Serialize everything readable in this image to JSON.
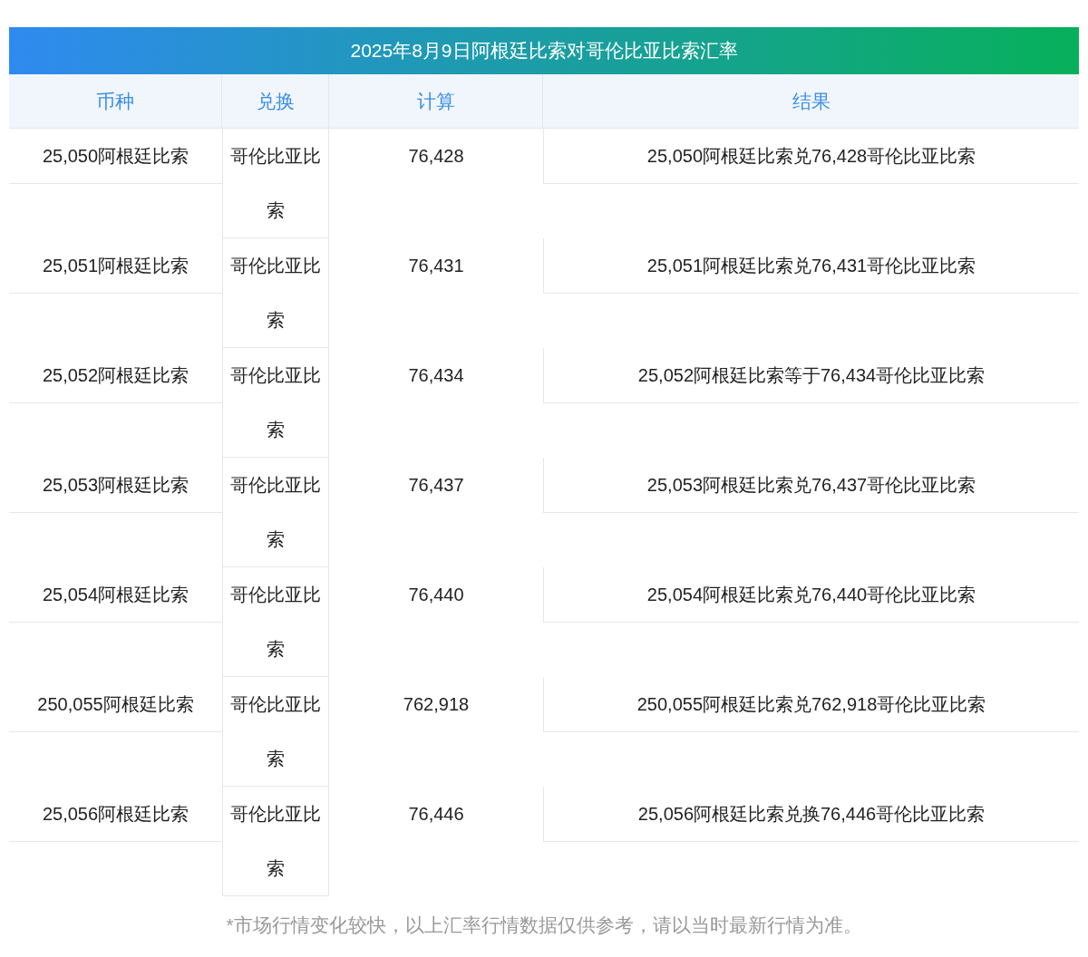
{
  "title": "2025年8月9日阿根廷比索对哥伦比亚比索汇率",
  "columns": [
    "币种",
    "兑换",
    "计算",
    "结果"
  ],
  "rows": [
    {
      "currency": "25,050阿根廷比索",
      "target": "哥伦比亚比索",
      "amount": "76,428",
      "result": "25,050阿根廷比索兑76,428哥伦比亚比索"
    },
    {
      "currency": "25,051阿根廷比索",
      "target": "哥伦比亚比索",
      "amount": "76,431",
      "result": "25,051阿根廷比索兑76,431哥伦比亚比索"
    },
    {
      "currency": "25,052阿根廷比索",
      "target": "哥伦比亚比索",
      "amount": "76,434",
      "result": "25,052阿根廷比索等于76,434哥伦比亚比索"
    },
    {
      "currency": "25,053阿根廷比索",
      "target": "哥伦比亚比索",
      "amount": "76,437",
      "result": "25,053阿根廷比索兑76,437哥伦比亚比索"
    },
    {
      "currency": "25,054阿根廷比索",
      "target": "哥伦比亚比索",
      "amount": "76,440",
      "result": "25,054阿根廷比索兑76,440哥伦比亚比索"
    },
    {
      "currency": "250,055阿根廷比索",
      "target": "哥伦比亚比索",
      "amount": "762,918",
      "result": "250,055阿根廷比索兑762,918哥伦比亚比索"
    },
    {
      "currency": "25,056阿根廷比索",
      "target": "哥伦比亚比索",
      "amount": "76,446",
      "result": "25,056阿根廷比索兑换76,446哥伦比亚比索"
    }
  ],
  "footnote": "*市场行情变化较快，以上汇率行情数据仅供参考，请以当时最新行情为准。"
}
